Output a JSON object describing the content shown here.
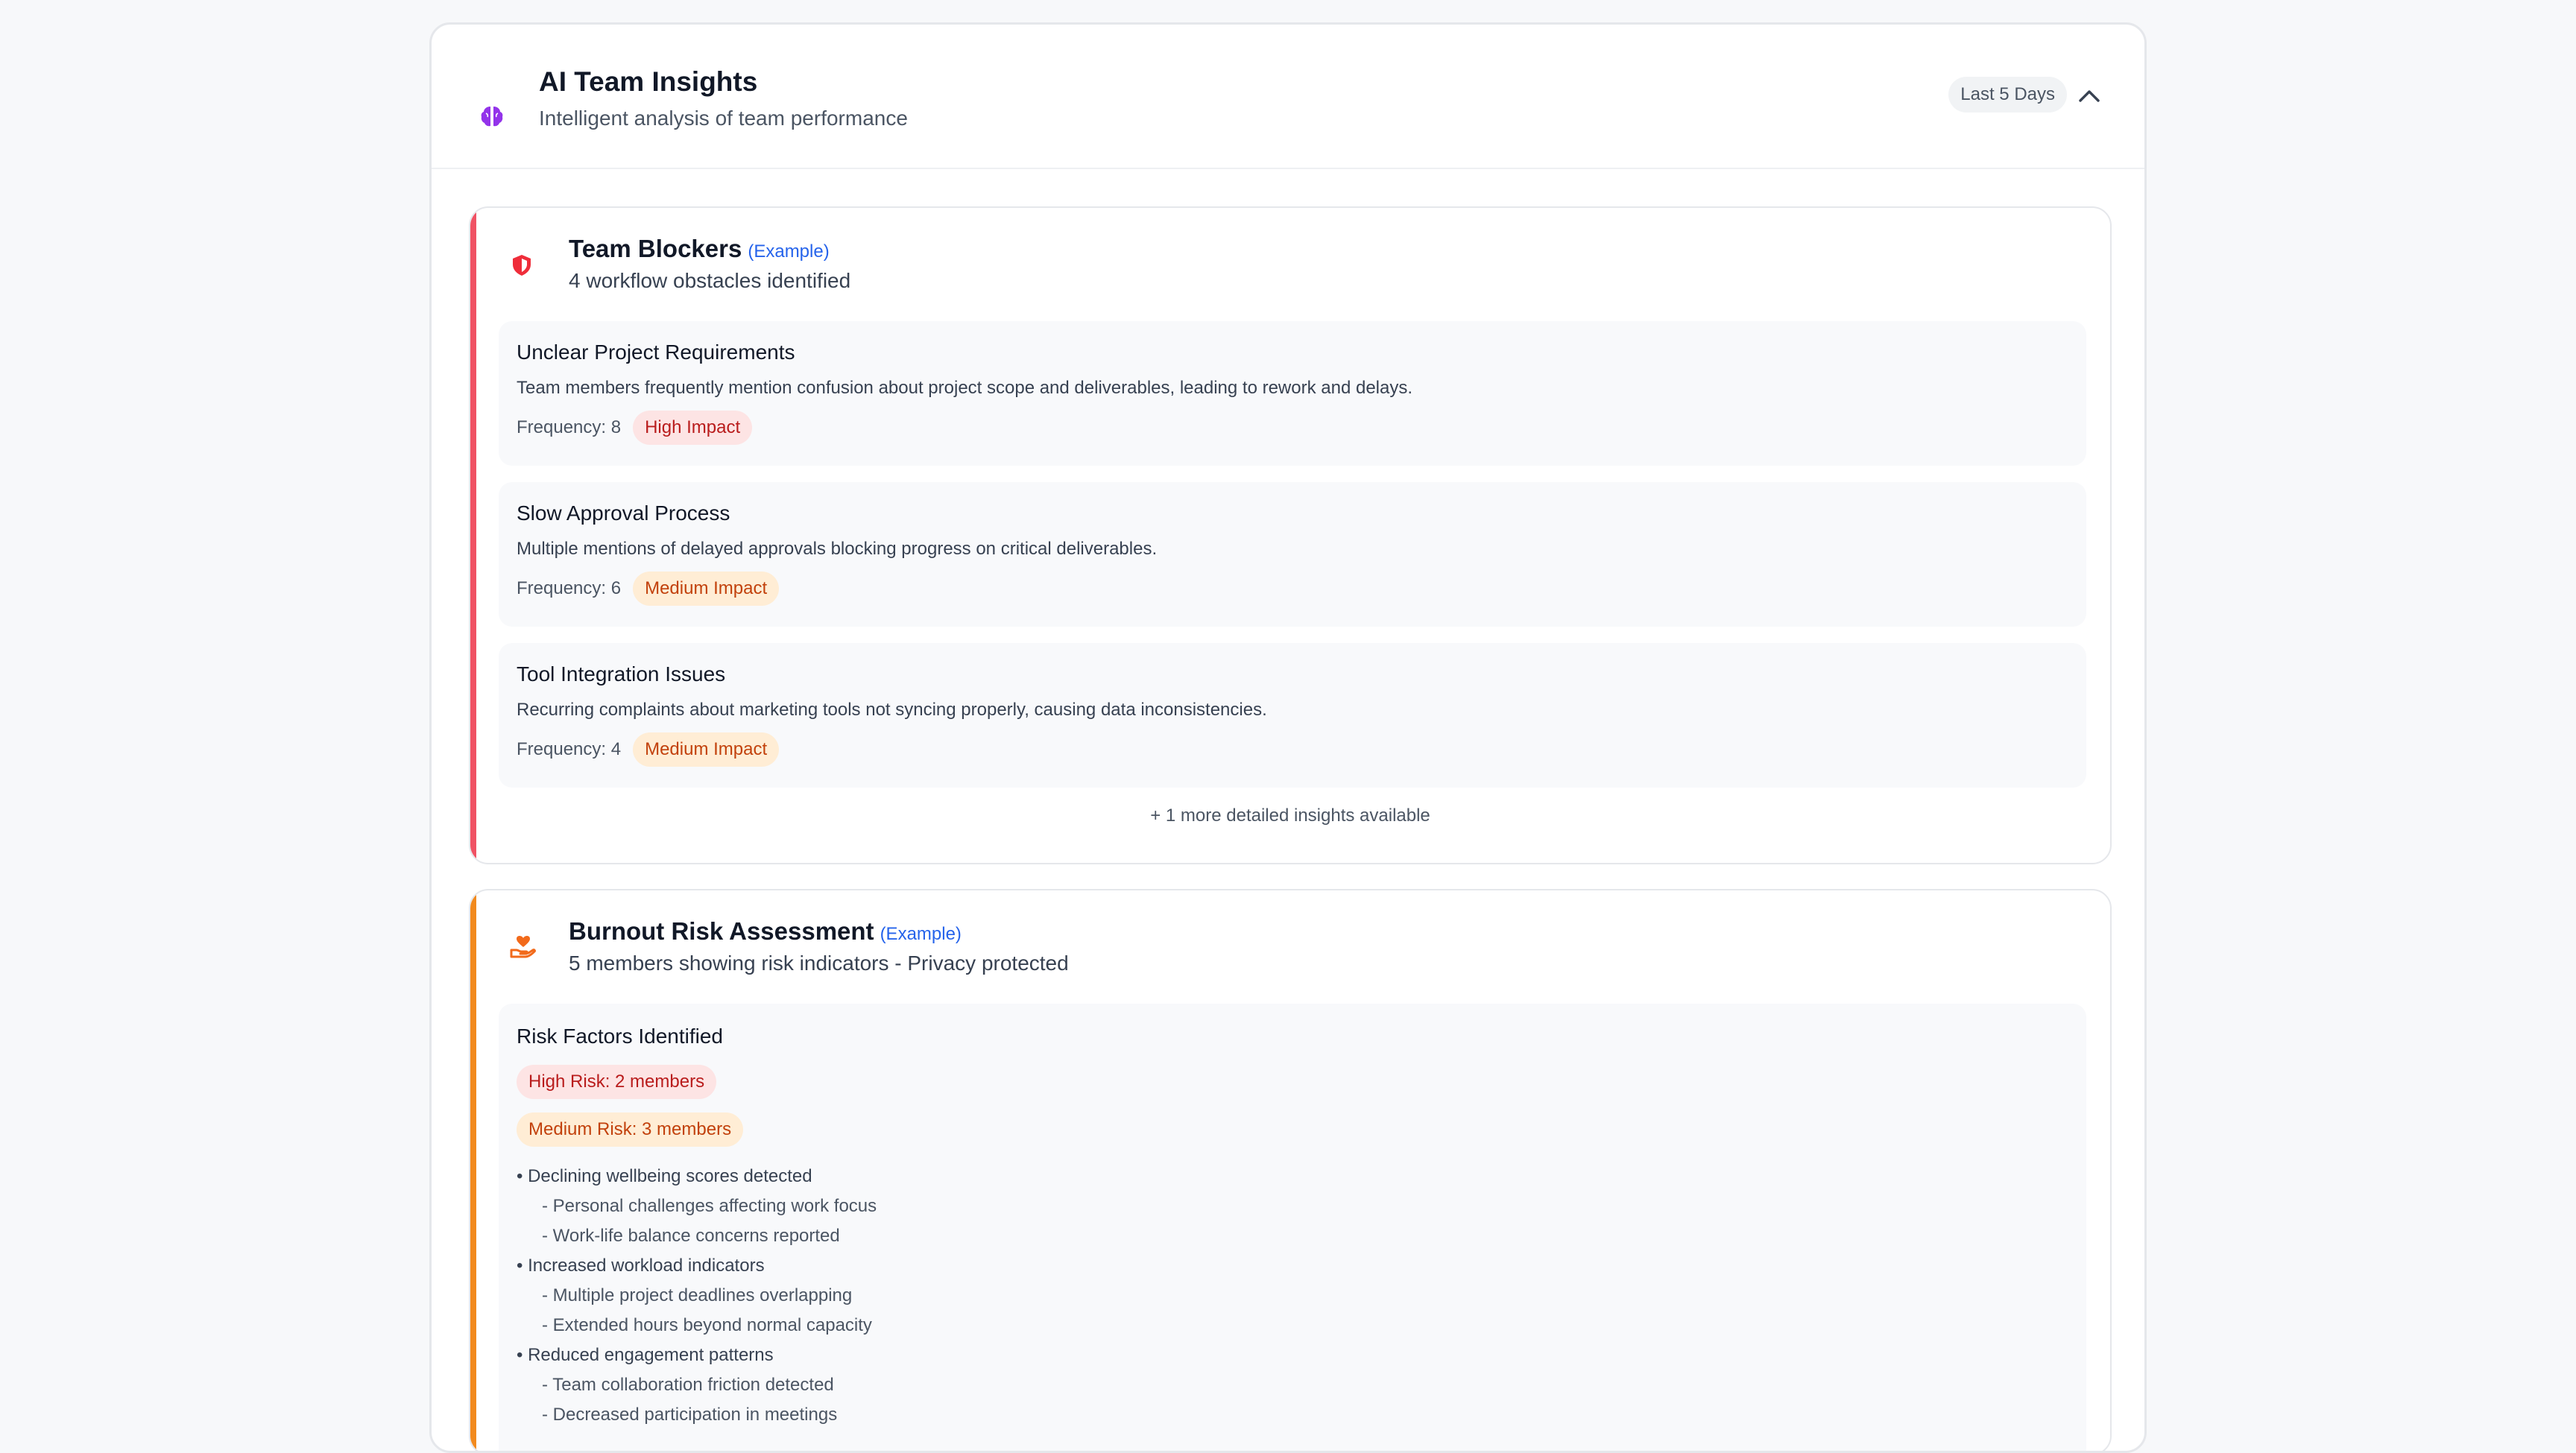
{
  "header": {
    "title": "AI Team Insights",
    "subtitle": "Intelligent analysis of team performance",
    "period": "Last 5 Days",
    "brain_icon": "brain-icon",
    "collapse_icon": "chevron-up-icon"
  },
  "colors": {
    "brain": "#9333ea",
    "blockers_accent": "#f05264",
    "burnout_accent": "#f28a1e",
    "shield": "#ef2d3a",
    "heart_hand": "#f26a1b",
    "example_link": "#2563eb"
  },
  "blockers": {
    "icon": "shield-icon",
    "title": "Team Blockers",
    "example": "(Example)",
    "subtitle": "4 workflow obstacles identified",
    "items": [
      {
        "title": "Unclear Project Requirements",
        "description": "Team members frequently mention confusion about project scope and deliverables, leading to rework and delays.",
        "frequency": "Frequency: 8",
        "impact": "High Impact"
      },
      {
        "title": "Slow Approval Process",
        "description": "Multiple mentions of delayed approvals blocking progress on critical deliverables.",
        "frequency": "Frequency: 6",
        "impact": "Medium Impact"
      },
      {
        "title": "Tool Integration Issues",
        "description": "Recurring complaints about marketing tools not syncing properly, causing data inconsistencies.",
        "frequency": "Frequency: 4",
        "impact": "Medium Impact"
      }
    ],
    "more": "+ 1 more detailed insights available"
  },
  "burnout": {
    "icon": "hand-heart-icon",
    "title": "Burnout Risk Assessment",
    "example": "(Example)",
    "subtitle": "5 members showing risk indicators - Privacy protected",
    "section_title": "Risk Factors Identified",
    "high_risk": "High Risk: 2 members",
    "medium_risk": "Medium Risk: 3 members",
    "factors": [
      {
        "label": "• Declining wellbeing scores detected",
        "subs": [
          "- Personal challenges affecting work focus",
          "- Work-life balance concerns reported"
        ]
      },
      {
        "label": "• Increased workload indicators",
        "subs": [
          "- Multiple project deadlines overlapping",
          "- Extended hours beyond normal capacity"
        ]
      },
      {
        "label": "• Reduced engagement patterns",
        "subs": [
          "- Team collaboration friction detected",
          "- Decreased participation in meetings"
        ]
      }
    ]
  }
}
